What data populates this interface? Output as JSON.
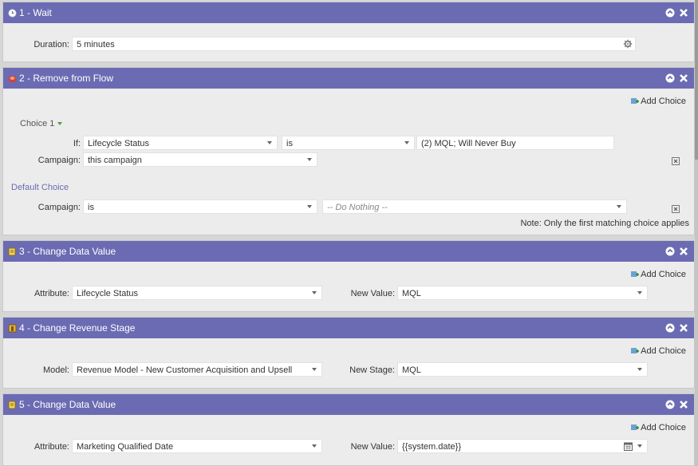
{
  "colors": {
    "header": "#6b6bb3",
    "panel": "#ececec",
    "field": "#ffffff"
  },
  "steps": [
    {
      "title": "1 - Wait",
      "icon": "clock-icon",
      "duration_label": "Duration:",
      "duration_value": "5 minutes"
    },
    {
      "title": "2 - Remove from Flow",
      "icon": "remove-flow-icon",
      "add_choice": "Add Choice",
      "choice_title": "Choice 1",
      "if_label": "If:",
      "if_field": "Lifecycle Status",
      "if_operator": "is",
      "if_value": "(2) MQL; Will Never Buy",
      "campaign_label": "Campaign:",
      "campaign_value": "this campaign",
      "default_choice": "Default Choice",
      "default_campaign_label": "Campaign:",
      "default_campaign_operator": "is",
      "default_campaign_value": "-- Do Nothing --",
      "note": "Note: Only the first matching choice applies"
    },
    {
      "title": "3 - Change Data Value",
      "icon": "change-data-icon",
      "add_choice": "Add Choice",
      "attribute_label": "Attribute:",
      "attribute_value": "Lifecycle Status",
      "new_value_label": "New Value:",
      "new_value": "MQL"
    },
    {
      "title": "4 - Change Revenue Stage",
      "icon": "revenue-stage-icon",
      "add_choice": "Add Choice",
      "model_label": "Model:",
      "model_value": "Revenue Model - New Customer Acquisition and Upsell",
      "new_stage_label": "New Stage:",
      "new_stage_value": "MQL"
    },
    {
      "title": "5 - Change Data Value",
      "icon": "change-data-icon",
      "add_choice": "Add Choice",
      "attribute_label": "Attribute:",
      "attribute_value": "Marketing Qualified Date",
      "new_value_label": "New Value:",
      "new_value": "{{system.date}}"
    }
  ]
}
